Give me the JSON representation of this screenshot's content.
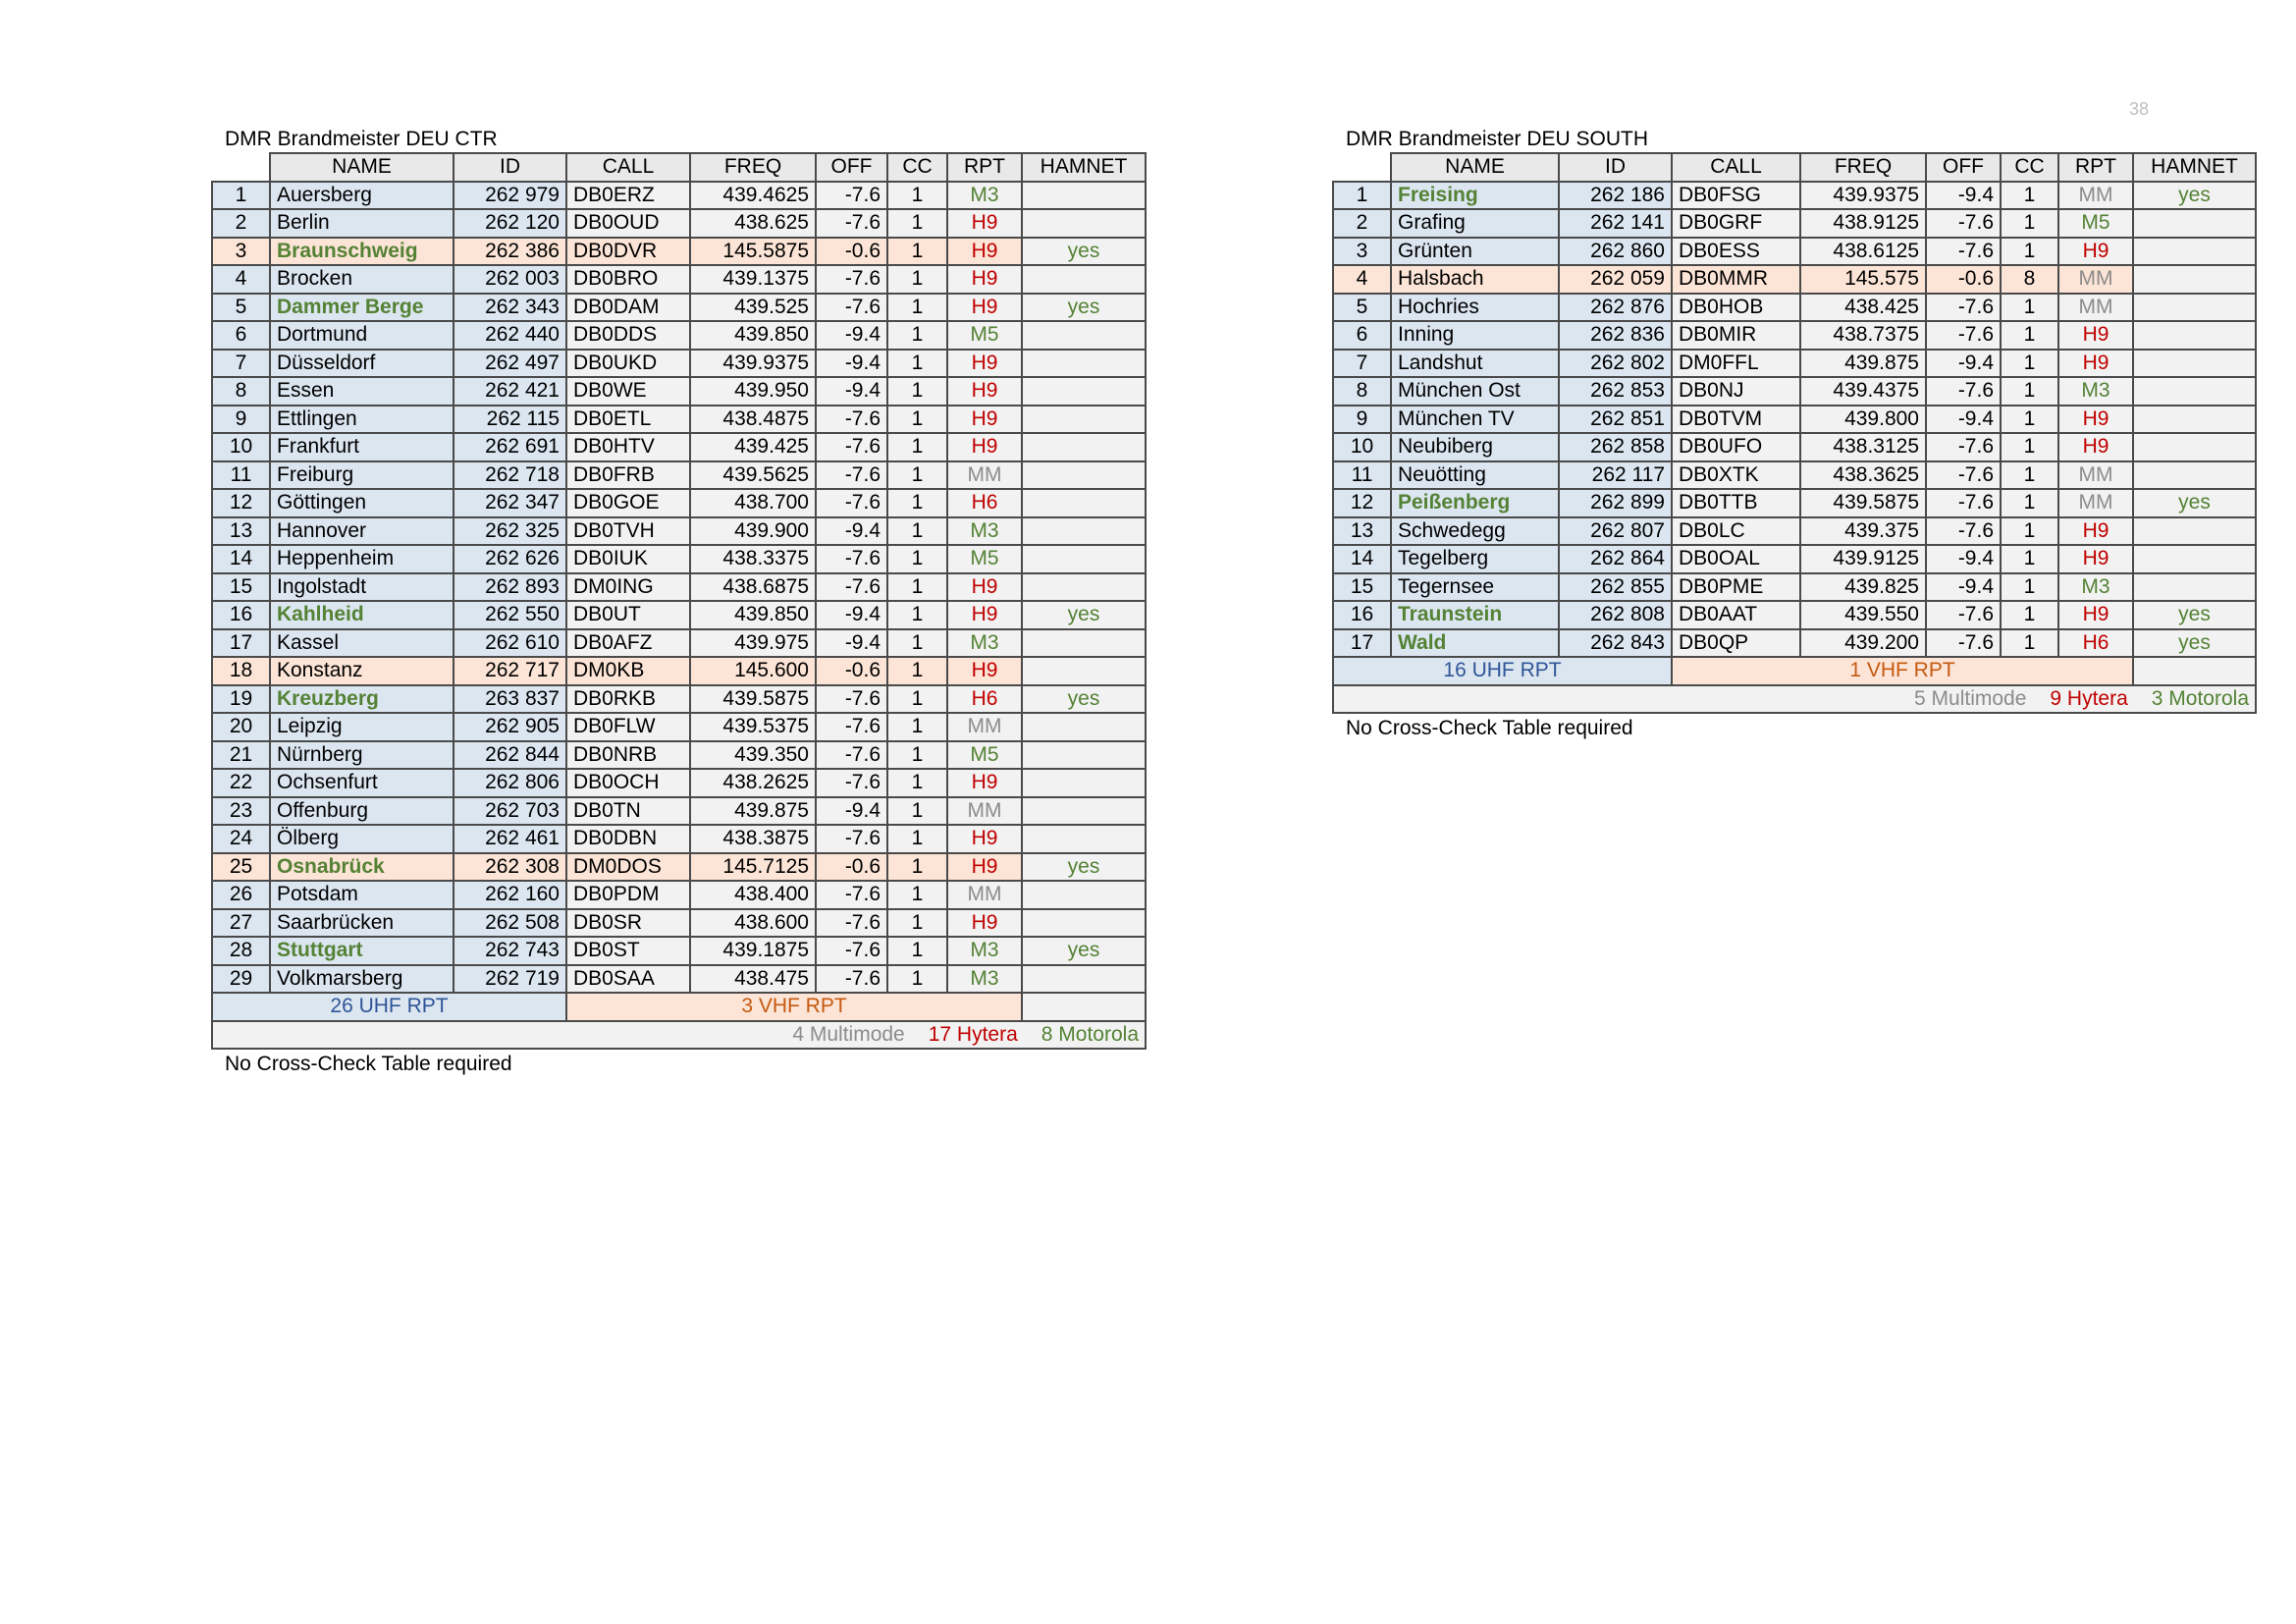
{
  "page_number": "38",
  "note": "No Cross-Check Table required",
  "columns": [
    "NAME",
    "ID",
    "CALL",
    "FREQ",
    "OFF",
    "CC",
    "RPT",
    "HAMNET"
  ],
  "ctr": {
    "title": "DMR Brandmeister DEU CTR",
    "rows": [
      {
        "num": "1",
        "name": "Auersberg",
        "id": "262 979",
        "call": "DB0ERZ",
        "freq": "439.4625",
        "off": "-7.6",
        "cc": "1",
        "rpt": "M3",
        "hamnet": "",
        "band": "uhf"
      },
      {
        "num": "2",
        "name": "Berlin",
        "id": "262 120",
        "call": "DB0OUD",
        "freq": "438.625",
        "off": "-7.6",
        "cc": "1",
        "rpt": "H9",
        "hamnet": "",
        "band": "uhf"
      },
      {
        "num": "3",
        "name": "Braunschweig",
        "id": "262 386",
        "call": "DB0DVR",
        "freq": "145.5875",
        "off": "-0.6",
        "cc": "1",
        "rpt": "H9",
        "hamnet": "yes",
        "band": "vhf"
      },
      {
        "num": "4",
        "name": "Brocken",
        "id": "262 003",
        "call": "DB0BRO",
        "freq": "439.1375",
        "off": "-7.6",
        "cc": "1",
        "rpt": "H9",
        "hamnet": "",
        "band": "uhf"
      },
      {
        "num": "5",
        "name": "Dammer Berge",
        "id": "262 343",
        "call": "DB0DAM",
        "freq": "439.525",
        "off": "-7.6",
        "cc": "1",
        "rpt": "H9",
        "hamnet": "yes",
        "band": "uhf"
      },
      {
        "num": "6",
        "name": "Dortmund",
        "id": "262 440",
        "call": "DB0DDS",
        "freq": "439.850",
        "off": "-9.4",
        "cc": "1",
        "rpt": "M5",
        "hamnet": "",
        "band": "uhf"
      },
      {
        "num": "7",
        "name": "Düsseldorf",
        "id": "262 497",
        "call": "DB0UKD",
        "freq": "439.9375",
        "off": "-9.4",
        "cc": "1",
        "rpt": "H9",
        "hamnet": "",
        "band": "uhf"
      },
      {
        "num": "8",
        "name": "Essen",
        "id": "262 421",
        "call": "DB0WE",
        "freq": "439.950",
        "off": "-9.4",
        "cc": "1",
        "rpt": "H9",
        "hamnet": "",
        "band": "uhf"
      },
      {
        "num": "9",
        "name": "Ettlingen",
        "id": "262 115",
        "call": "DB0ETL",
        "freq": "438.4875",
        "off": "-7.6",
        "cc": "1",
        "rpt": "H9",
        "hamnet": "",
        "band": "uhf"
      },
      {
        "num": "10",
        "name": "Frankfurt",
        "id": "262 691",
        "call": "DB0HTV",
        "freq": "439.425",
        "off": "-7.6",
        "cc": "1",
        "rpt": "H9",
        "hamnet": "",
        "band": "uhf"
      },
      {
        "num": "11",
        "name": "Freiburg",
        "id": "262 718",
        "call": "DB0FRB",
        "freq": "439.5625",
        "off": "-7.6",
        "cc": "1",
        "rpt": "MM",
        "hamnet": "",
        "band": "uhf"
      },
      {
        "num": "12",
        "name": "Göttingen",
        "id": "262 347",
        "call": "DB0GOE",
        "freq": "438.700",
        "off": "-7.6",
        "cc": "1",
        "rpt": "H6",
        "hamnet": "",
        "band": "uhf"
      },
      {
        "num": "13",
        "name": "Hannover",
        "id": "262 325",
        "call": "DB0TVH",
        "freq": "439.900",
        "off": "-9.4",
        "cc": "1",
        "rpt": "M3",
        "hamnet": "",
        "band": "uhf"
      },
      {
        "num": "14",
        "name": "Heppenheim",
        "id": "262 626",
        "call": "DB0IUK",
        "freq": "438.3375",
        "off": "-7.6",
        "cc": "1",
        "rpt": "M5",
        "hamnet": "",
        "band": "uhf"
      },
      {
        "num": "15",
        "name": "Ingolstadt",
        "id": "262 893",
        "call": "DM0ING",
        "freq": "438.6875",
        "off": "-7.6",
        "cc": "1",
        "rpt": "H9",
        "hamnet": "",
        "band": "uhf"
      },
      {
        "num": "16",
        "name": "Kahlheid",
        "id": "262 550",
        "call": "DB0UT",
        "freq": "439.850",
        "off": "-9.4",
        "cc": "1",
        "rpt": "H9",
        "hamnet": "yes",
        "band": "uhf"
      },
      {
        "num": "17",
        "name": "Kassel",
        "id": "262 610",
        "call": "DB0AFZ",
        "freq": "439.975",
        "off": "-9.4",
        "cc": "1",
        "rpt": "M3",
        "hamnet": "",
        "band": "uhf"
      },
      {
        "num": "18",
        "name": "Konstanz",
        "id": "262 717",
        "call": "DM0KB",
        "freq": "145.600",
        "off": "-0.6",
        "cc": "1",
        "rpt": "H9",
        "hamnet": "",
        "band": "vhf"
      },
      {
        "num": "19",
        "name": "Kreuzberg",
        "id": "263 837",
        "call": "DB0RKB",
        "freq": "439.5875",
        "off": "-7.6",
        "cc": "1",
        "rpt": "H6",
        "hamnet": "yes",
        "band": "uhf"
      },
      {
        "num": "20",
        "name": "Leipzig",
        "id": "262 905",
        "call": "DB0FLW",
        "freq": "439.5375",
        "off": "-7.6",
        "cc": "1",
        "rpt": "MM",
        "hamnet": "",
        "band": "uhf"
      },
      {
        "num": "21",
        "name": "Nürnberg",
        "id": "262 844",
        "call": "DB0NRB",
        "freq": "439.350",
        "off": "-7.6",
        "cc": "1",
        "rpt": "M5",
        "hamnet": "",
        "band": "uhf"
      },
      {
        "num": "22",
        "name": "Ochsenfurt",
        "id": "262 806",
        "call": "DB0OCH",
        "freq": "438.2625",
        "off": "-7.6",
        "cc": "1",
        "rpt": "H9",
        "hamnet": "",
        "band": "uhf"
      },
      {
        "num": "23",
        "name": "Offenburg",
        "id": "262 703",
        "call": "DB0TN",
        "freq": "439.875",
        "off": "-9.4",
        "cc": "1",
        "rpt": "MM",
        "hamnet": "",
        "band": "uhf"
      },
      {
        "num": "24",
        "name": "Ölberg",
        "id": "262 461",
        "call": "DB0DBN",
        "freq": "438.3875",
        "off": "-7.6",
        "cc": "1",
        "rpt": "H9",
        "hamnet": "",
        "band": "uhf"
      },
      {
        "num": "25",
        "name": "Osnabrück",
        "id": "262 308",
        "call": "DM0DOS",
        "freq": "145.7125",
        "off": "-0.6",
        "cc": "1",
        "rpt": "H9",
        "hamnet": "yes",
        "band": "vhf"
      },
      {
        "num": "26",
        "name": "Potsdam",
        "id": "262 160",
        "call": "DB0PDM",
        "freq": "438.400",
        "off": "-7.6",
        "cc": "1",
        "rpt": "MM",
        "hamnet": "",
        "band": "uhf"
      },
      {
        "num": "27",
        "name": "Saarbrücken",
        "id": "262 508",
        "call": "DB0SR",
        "freq": "438.600",
        "off": "-7.6",
        "cc": "1",
        "rpt": "H9",
        "hamnet": "",
        "band": "uhf"
      },
      {
        "num": "28",
        "name": "Stuttgart",
        "id": "262 743",
        "call": "DB0ST",
        "freq": "439.1875",
        "off": "-7.6",
        "cc": "1",
        "rpt": "M3",
        "hamnet": "yes",
        "band": "uhf"
      },
      {
        "num": "29",
        "name": "Volkmarsberg",
        "id": "262 719",
        "call": "DB0SAA",
        "freq": "438.475",
        "off": "-7.6",
        "cc": "1",
        "rpt": "M3",
        "hamnet": "",
        "band": "uhf"
      }
    ],
    "summary": {
      "uhf": "26  UHF RPT",
      "vhf": "3 VHF RPT",
      "multimode": "4 Multimode",
      "hytera": "17 Hytera",
      "motorola": "8 Motorola"
    }
  },
  "south": {
    "title": "DMR Brandmeister DEU SOUTH",
    "rows": [
      {
        "num": "1",
        "name": "Freising",
        "id": "262 186",
        "call": "DB0FSG",
        "freq": "439.9375",
        "off": "-9.4",
        "cc": "1",
        "rpt": "MM",
        "hamnet": "yes",
        "band": "uhf"
      },
      {
        "num": "2",
        "name": "Grafing",
        "id": "262 141",
        "call": "DB0GRF",
        "freq": "438.9125",
        "off": "-7.6",
        "cc": "1",
        "rpt": "M5",
        "hamnet": "",
        "band": "uhf"
      },
      {
        "num": "3",
        "name": "Grünten",
        "id": "262 860",
        "call": "DB0ESS",
        "freq": "438.6125",
        "off": "-7.6",
        "cc": "1",
        "rpt": "H9",
        "hamnet": "",
        "band": "uhf"
      },
      {
        "num": "4",
        "name": "Halsbach",
        "id": "262 059",
        "call": "DB0MMR",
        "freq": "145.575",
        "off": "-0.6",
        "cc": "8",
        "rpt": "MM",
        "hamnet": "",
        "band": "vhf"
      },
      {
        "num": "5",
        "name": "Hochries",
        "id": "262 876",
        "call": "DB0HOB",
        "freq": "438.425",
        "off": "-7.6",
        "cc": "1",
        "rpt": "MM",
        "hamnet": "",
        "band": "uhf"
      },
      {
        "num": "6",
        "name": "Inning",
        "id": "262 836",
        "call": "DB0MIR",
        "freq": "438.7375",
        "off": "-7.6",
        "cc": "1",
        "rpt": "H9",
        "hamnet": "",
        "band": "uhf"
      },
      {
        "num": "7",
        "name": "Landshut",
        "id": "262 802",
        "call": "DM0FFL",
        "freq": "439.875",
        "off": "-9.4",
        "cc": "1",
        "rpt": "H9",
        "hamnet": "",
        "band": "uhf"
      },
      {
        "num": "8",
        "name": "München Ost",
        "id": "262 853",
        "call": "DB0NJ",
        "freq": "439.4375",
        "off": "-7.6",
        "cc": "1",
        "rpt": "M3",
        "hamnet": "",
        "band": "uhf"
      },
      {
        "num": "9",
        "name": "München TV",
        "id": "262 851",
        "call": "DB0TVM",
        "freq": "439.800",
        "off": "-9.4",
        "cc": "1",
        "rpt": "H9",
        "hamnet": "",
        "band": "uhf"
      },
      {
        "num": "10",
        "name": "Neubiberg",
        "id": "262 858",
        "call": "DB0UFO",
        "freq": "438.3125",
        "off": "-7.6",
        "cc": "1",
        "rpt": "H9",
        "hamnet": "",
        "band": "uhf"
      },
      {
        "num": "11",
        "name": "Neuötting",
        "id": "262 117",
        "call": "DB0XTK",
        "freq": "438.3625",
        "off": "-7.6",
        "cc": "1",
        "rpt": "MM",
        "hamnet": "",
        "band": "uhf"
      },
      {
        "num": "12",
        "name": "Peißenberg",
        "id": "262 899",
        "call": "DB0TTB",
        "freq": "439.5875",
        "off": "-7.6",
        "cc": "1",
        "rpt": "MM",
        "hamnet": "yes",
        "band": "uhf"
      },
      {
        "num": "13",
        "name": "Schwedegg",
        "id": "262 807",
        "call": "DB0LC",
        "freq": "439.375",
        "off": "-7.6",
        "cc": "1",
        "rpt": "H9",
        "hamnet": "",
        "band": "uhf"
      },
      {
        "num": "14",
        "name": "Tegelberg",
        "id": "262 864",
        "call": "DB0OAL",
        "freq": "439.9125",
        "off": "-9.4",
        "cc": "1",
        "rpt": "H9",
        "hamnet": "",
        "band": "uhf"
      },
      {
        "num": "15",
        "name": "Tegernsee",
        "id": "262 855",
        "call": "DB0PME",
        "freq": "439.825",
        "off": "-9.4",
        "cc": "1",
        "rpt": "M3",
        "hamnet": "",
        "band": "uhf"
      },
      {
        "num": "16",
        "name": "Traunstein",
        "id": "262 808",
        "call": "DB0AAT",
        "freq": "439.550",
        "off": "-7.6",
        "cc": "1",
        "rpt": "H9",
        "hamnet": "yes",
        "band": "uhf"
      },
      {
        "num": "17",
        "name": "Wald",
        "id": "262 843",
        "call": "DB0QP",
        "freq": "439.200",
        "off": "-7.6",
        "cc": "1",
        "rpt": "H6",
        "hamnet": "yes",
        "band": "uhf"
      }
    ],
    "summary": {
      "uhf": "16  UHF RPT",
      "vhf": "1 VHF RPT",
      "multimode": "5 Multimode",
      "hytera": "9 Hytera",
      "motorola": "3 Motorola"
    }
  }
}
